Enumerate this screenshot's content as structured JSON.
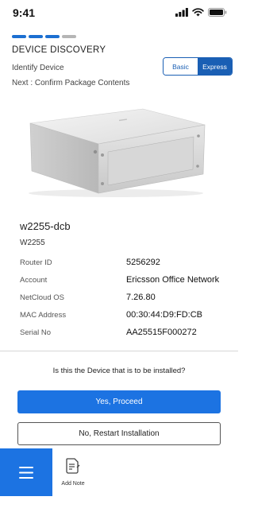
{
  "status": {
    "time": "9:41"
  },
  "progress_steps": [
    {
      "state": "done"
    },
    {
      "state": "done"
    },
    {
      "state": "done"
    },
    {
      "state": "pending"
    }
  ],
  "header": {
    "title": "DEVICE DISCOVERY",
    "subtitle": "Identify Device",
    "next": "Next : Confirm Package Contents"
  },
  "mode_toggle": {
    "basic_label": "Basic",
    "express_label": "Express",
    "selected": "Express"
  },
  "device": {
    "name": "w2255-dcb",
    "model": "W2255",
    "details": [
      {
        "label": "Router ID",
        "value": "5256292"
      },
      {
        "label": "Account",
        "value": "Ericsson Office Network"
      },
      {
        "label": "NetCloud OS",
        "value": "7.26.80"
      },
      {
        "label": "MAC Address",
        "value": "00:30:44:D9:FD:CB"
      },
      {
        "label": "Serial No",
        "value": "AA25515F000272"
      }
    ]
  },
  "confirm": {
    "question": "Is this the Device that is to be installed?",
    "yes_label": "Yes, Proceed",
    "no_label": "No, Restart Installation"
  },
  "bottom": {
    "add_note_label": "Add Note"
  },
  "colors": {
    "primary": "#1c73e2",
    "toggle_border": "#1a5fb4",
    "inactive_step": "#b5b5b5"
  }
}
